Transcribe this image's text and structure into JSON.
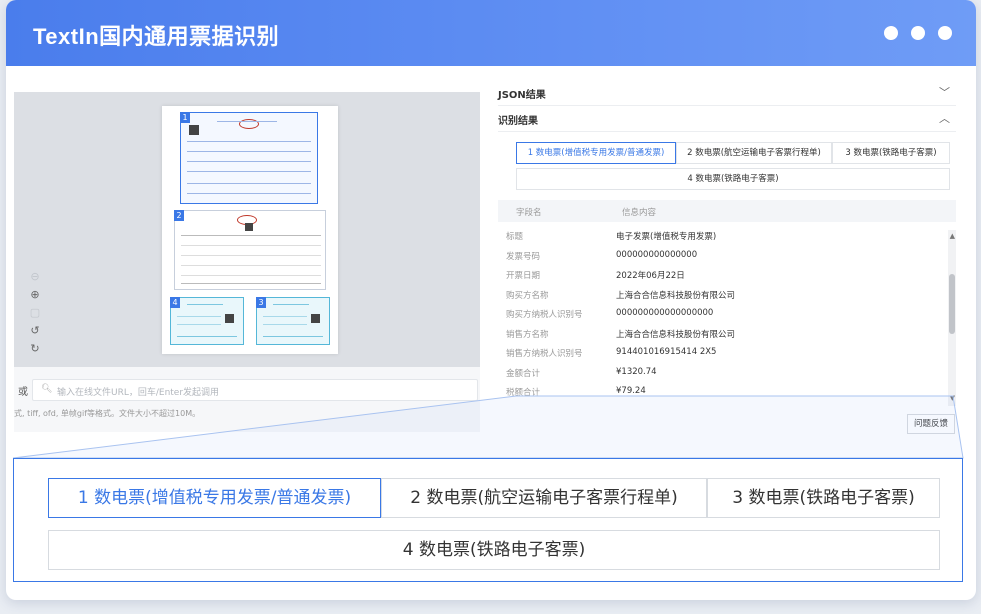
{
  "app": {
    "title": "TextIn国内通用票据识别"
  },
  "colors": {
    "brand_blue": "#4a7dec",
    "accent_blue": "#3a78e6",
    "title_text": "#ffffff",
    "background": "#e9edf3"
  },
  "window_controls": [
    "dot-icon",
    "dot-icon",
    "dot-icon"
  ],
  "preview": {
    "invoices": [
      {
        "number": "1"
      },
      {
        "number": "2"
      },
      {
        "number": "4"
      },
      {
        "number": "3"
      }
    ],
    "zoom_tools": [
      "zoom-out-icon",
      "zoom-in-icon",
      "fit-icon",
      "rotate-left-icon",
      "rotate-right-icon"
    ],
    "url_prefix": "或",
    "url_placeholder": "输入在线文件URL，回车/Enter发起调用",
    "hint": "式, tiff, ofd, 单帧gif等格式。文件大小不超过10M。"
  },
  "results": {
    "json_section_label": "JSON结果",
    "recognition_section_label": "识别结果",
    "tabs": [
      "1 数电票(增值税专用发票/普通发票)",
      "2 数电票(航空运输电子客票行程单)",
      "3 数电票(铁路电子客票)",
      "4 数电票(铁路电子客票)"
    ],
    "active_tab": 0,
    "table_headers": [
      "字段名",
      "信息内容"
    ],
    "rows": [
      {
        "key": "标题",
        "value": "电子发票(增值税专用发票)"
      },
      {
        "key": "发票号码",
        "value": "000000000000000"
      },
      {
        "key": "开票日期",
        "value": "2022年06月22日"
      },
      {
        "key": "购买方名称",
        "value": "上海合合信息科技股份有限公司"
      },
      {
        "key": "购买方纳税人识别号",
        "value": "000000000000000000"
      },
      {
        "key": "销售方名称",
        "value": "上海合合信息科技股份有限公司"
      },
      {
        "key": "销售方纳税人识别号",
        "value": "914401016915414 2X5"
      },
      {
        "key": "金额合计",
        "value": "¥1320.74"
      },
      {
        "key": "税额合计",
        "value": "¥79.24"
      }
    ],
    "feedback_label": "问题反馈"
  },
  "zoom_callout": {
    "tabs": [
      "1 数电票(增值税专用发票/普通发票)",
      "2 数电票(航空运输电子客票行程单)",
      "3 数电票(铁路电子客票)",
      "4 数电票(铁路电子客票)"
    ],
    "active_tab": 0
  }
}
